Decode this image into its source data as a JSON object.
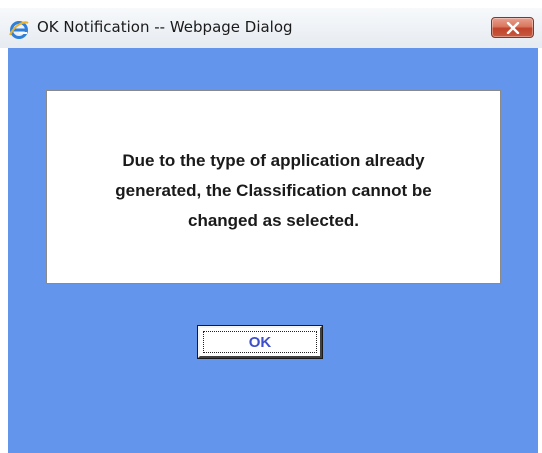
{
  "window": {
    "title": "OK Notification -- Webpage Dialog",
    "title_icon": "internet-explorer-icon",
    "close_icon": "close-icon"
  },
  "dialog": {
    "message_lines": [
      "Due to the type of application already",
      "generated, the Classification cannot be",
      "changed as selected."
    ],
    "ok_label": "OK"
  },
  "colors": {
    "background": "#6495ed",
    "close_button": "#c85a3f",
    "ok_text": "#3d4fc9"
  }
}
